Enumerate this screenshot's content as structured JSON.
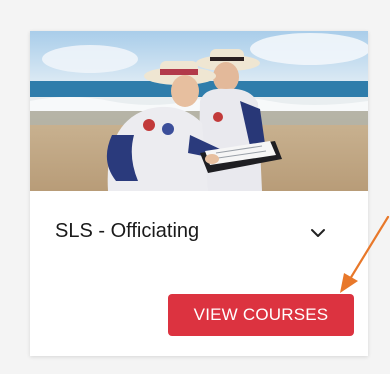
{
  "card": {
    "title": "SLS - Officiating",
    "button_label": "VIEW COURSES",
    "image_alt": "Two surf lifesaving officials in wide-brimmed hats reviewing a clipboard on the beach",
    "expand_icon": "chevron-down-icon"
  },
  "annotation": {
    "arrow_color": "#e8782a",
    "icon": "arrow-icon"
  },
  "colors": {
    "button": "#dc3340",
    "button_text": "#ffffff",
    "background": "#f4f4f4",
    "card": "#ffffff",
    "title_text": "#1a1a1a"
  }
}
